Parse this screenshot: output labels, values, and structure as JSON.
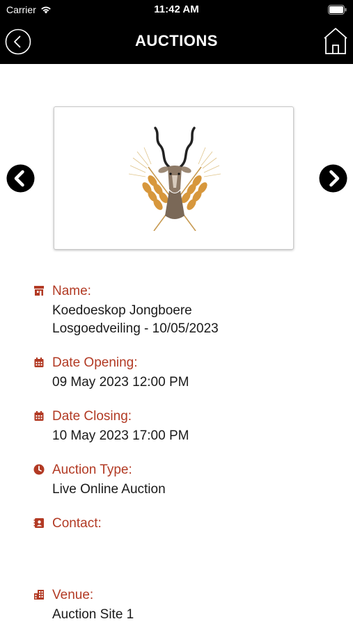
{
  "status_bar": {
    "carrier": "Carrier",
    "time": "11:42 AM"
  },
  "nav": {
    "title": "AUCTIONS"
  },
  "colors": {
    "accent": "#b23a24",
    "nav_bg": "#000000"
  },
  "carousel": {
    "image": "kudu-wheat-logo"
  },
  "details": {
    "name": {
      "label": "Name:",
      "line1": "Koedoeskop Jongboere",
      "line2": "Losgoedveiling - 10/05/2023",
      "icon": "store-icon"
    },
    "opening": {
      "label": "Date Opening:",
      "value": "09 May 2023 12:00 PM",
      "icon": "calendar-icon"
    },
    "closing": {
      "label": "Date Closing:",
      "value": "10 May 2023 17:00 PM",
      "icon": "calendar-icon"
    },
    "type": {
      "label": "Auction Type:",
      "value": "Live Online Auction",
      "icon": "clock-icon"
    },
    "contact": {
      "label": "Contact:",
      "value": "",
      "icon": "contact-card-icon"
    },
    "venue": {
      "label": "Venue:",
      "value": "Auction Site 1",
      "icon": "building-icon"
    }
  }
}
